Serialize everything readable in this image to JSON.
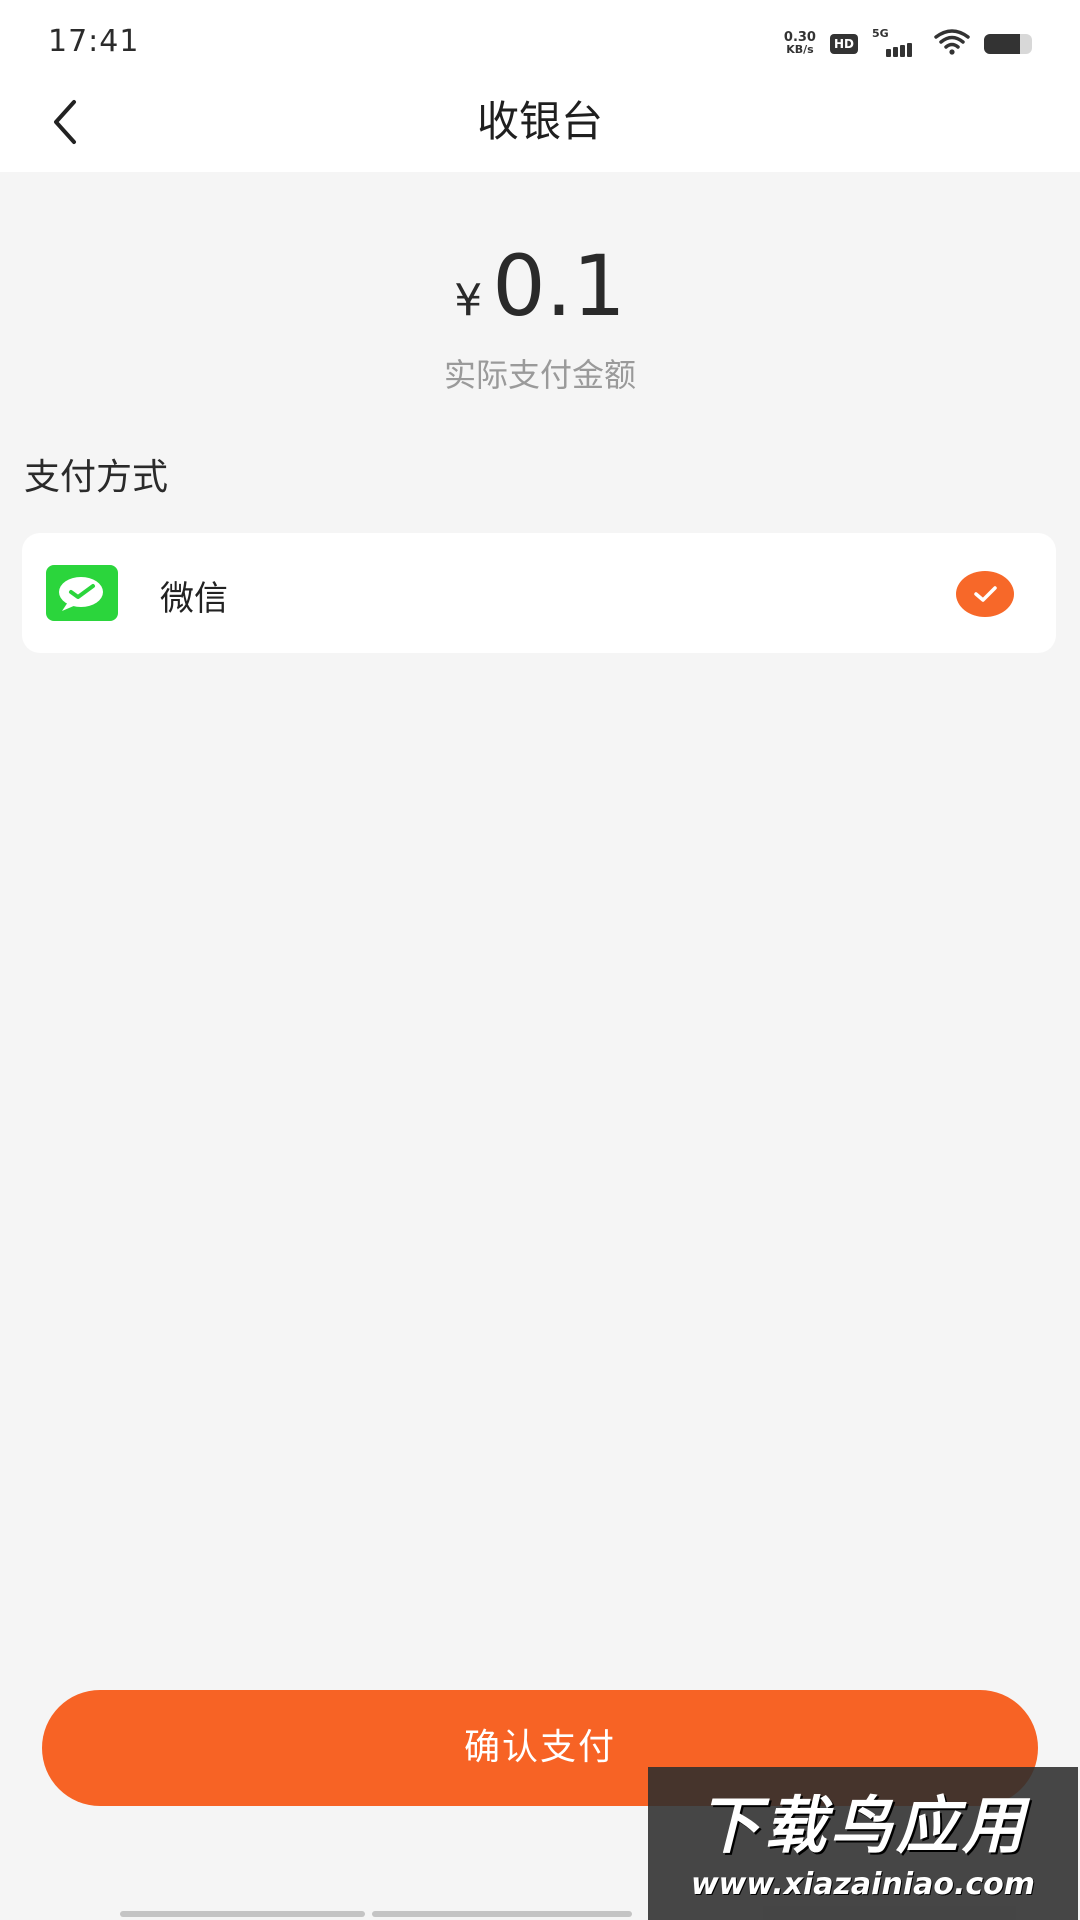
{
  "status_bar": {
    "time": "17:41",
    "net_speed_value": "0.30",
    "net_speed_unit": "KB/s",
    "hd_label": "HD",
    "network_label": "5G",
    "battery_level": 0.75,
    "icons": [
      "wifi-icon",
      "signal-icon",
      "battery-icon"
    ]
  },
  "header": {
    "title": "收银台",
    "back_icon": "chevron-left-icon"
  },
  "payment": {
    "currency_symbol": "¥",
    "amount": "0.1",
    "amount_label": "实际支付金额"
  },
  "methods": {
    "section_title": "支付方式",
    "items": [
      {
        "name": "微信",
        "icon": "wechat-pay-icon",
        "selected": true
      }
    ]
  },
  "footer": {
    "confirm_label": "确认支付"
  },
  "watermark": {
    "title": "下载鸟应用",
    "url": "www.xiazainiao.com"
  },
  "colors": {
    "accent": "#f76325",
    "check": "#f76829",
    "wechat_green": "#2bd53c",
    "background": "#f5f5f5",
    "card": "#ffffff"
  }
}
